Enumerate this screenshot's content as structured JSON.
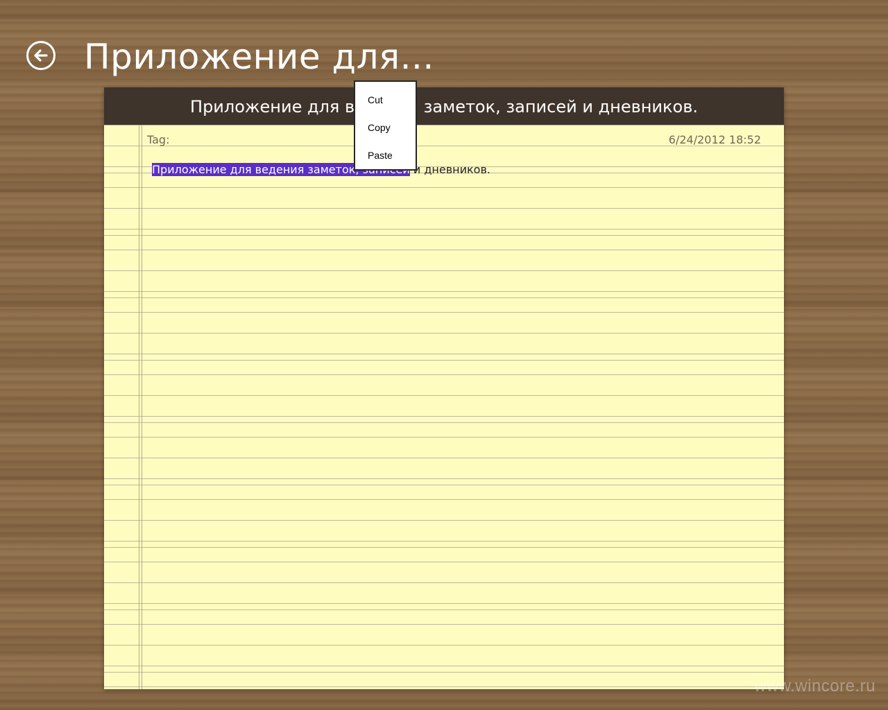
{
  "app": {
    "title": "Приложение для...",
    "back_icon": "back-arrow-icon"
  },
  "note": {
    "header_title": "Приложение для ведения заметок, записей и дневников.",
    "tag_label": "Tag:",
    "timestamp": "6/24/2012 18:52",
    "body_selected": "Приложение для ведения заметок, записей",
    "body_rest": " и дневников.",
    "paper_color": "#fffcc0",
    "header_color": "#3f342c",
    "selection_color": "#5a2ec8"
  },
  "context_menu": {
    "items": [
      {
        "label": "Cut"
      },
      {
        "label": "Copy"
      },
      {
        "label": "Paste"
      }
    ]
  },
  "watermark": {
    "text": "www.wincore.ru"
  }
}
